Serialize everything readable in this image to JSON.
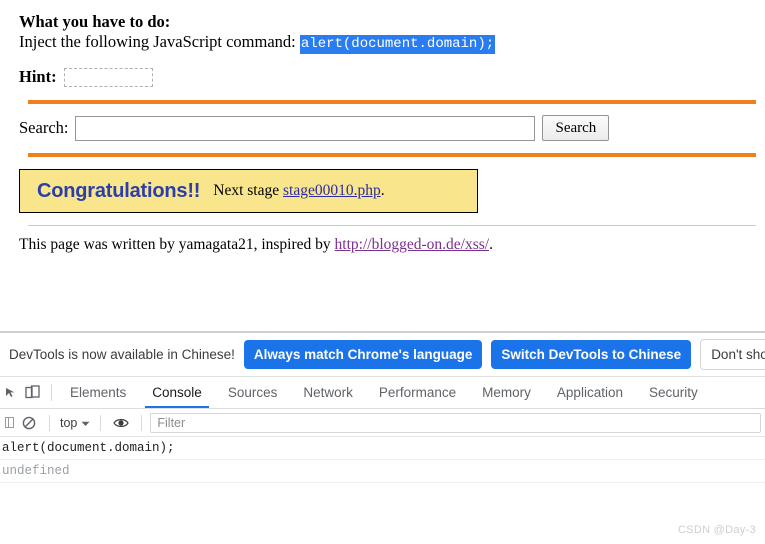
{
  "page": {
    "task_heading": "What you have to do:",
    "task_instruction": "Inject the following JavaScript command:",
    "task_command": "alert(document.domain);",
    "hint_label": "Hint:",
    "hint_value": "",
    "hint_placeholder": "",
    "search_label": "Search:",
    "search_value": "",
    "search_placeholder": "",
    "search_button": "Search",
    "congrats_text": "Congratulations!!",
    "next_stage_prefix": "Next stage",
    "next_stage_link": "stage00010.php",
    "next_stage_suffix": ".",
    "credit_prefix": "This page was written by yamagata21, inspired by",
    "credit_link": "http://blogged-on.de/xss/",
    "credit_suffix": "."
  },
  "devtools": {
    "notification": {
      "message": "DevTools is now available in Chinese!",
      "btn_always_match": "Always match Chrome's language",
      "btn_switch": "Switch DevTools to Chinese",
      "btn_dismiss": "Don't show again"
    },
    "icons": {
      "device_toolbar": "device-toolbar-icon",
      "clear_console": "clear-console-icon",
      "eye": "eye-icon",
      "chevron": "chevron-down-icon"
    },
    "tabs": [
      {
        "label": "Elements",
        "active": false
      },
      {
        "label": "Console",
        "active": true
      },
      {
        "label": "Sources",
        "active": false
      },
      {
        "label": "Network",
        "active": false
      },
      {
        "label": "Performance",
        "active": false
      },
      {
        "label": "Memory",
        "active": false
      },
      {
        "label": "Application",
        "active": false
      },
      {
        "label": "Security",
        "active": false
      }
    ],
    "filterbar": {
      "context_label": "top",
      "filter_placeholder": "Filter",
      "filter_value": ""
    },
    "console_rows": [
      {
        "text": "alert(document.domain);",
        "kind": "input"
      },
      {
        "text": "undefined",
        "kind": "result"
      }
    ]
  },
  "watermark": "CSDN @Day-3",
  "colors": {
    "orange_rule": "#ef7f1f",
    "congrats_bg": "#f8e58c",
    "congrats_fg": "#2c3fa8",
    "selection_blue": "#2a7df0",
    "devtools_blue": "#1a73e8",
    "visited_link": "#7b2f8e"
  }
}
